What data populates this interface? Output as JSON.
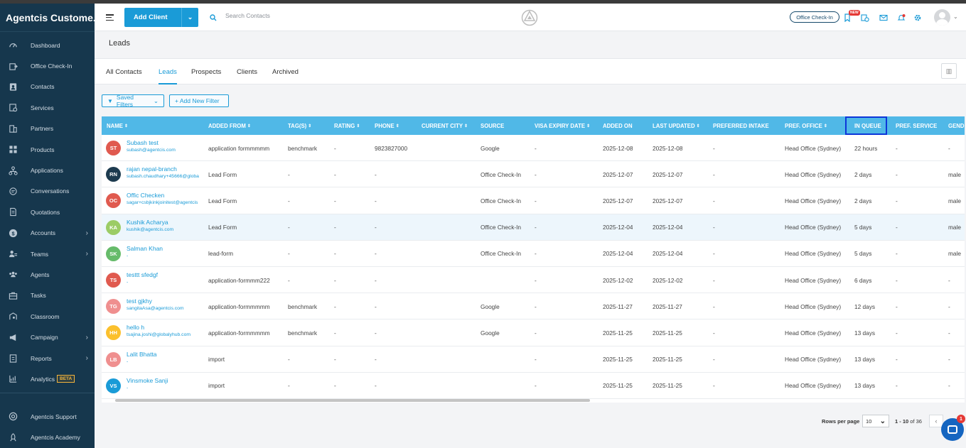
{
  "app": {
    "brand": "Agentcis Custome..."
  },
  "sidebar": {
    "items": [
      {
        "label": "Dashboard",
        "icon": "gauge-icon",
        "chev": false
      },
      {
        "label": "Office Check-In",
        "icon": "checkin-icon",
        "chev": false
      },
      {
        "label": "Contacts",
        "icon": "contacts-icon",
        "chev": false
      },
      {
        "label": "Services",
        "icon": "services-icon",
        "chev": false
      },
      {
        "label": "Partners",
        "icon": "building-icon",
        "chev": false
      },
      {
        "label": "Products",
        "icon": "grid-icon",
        "chev": false
      },
      {
        "label": "Applications",
        "icon": "flow-icon",
        "chev": false
      },
      {
        "label": "Conversations",
        "icon": "chat-icon",
        "chev": false
      },
      {
        "label": "Quotations",
        "icon": "document-icon",
        "chev": false
      },
      {
        "label": "Accounts",
        "icon": "dollar-icon",
        "chev": true
      },
      {
        "label": "Teams",
        "icon": "team-icon",
        "chev": true
      },
      {
        "label": "Agents",
        "icon": "agents-icon",
        "chev": false
      },
      {
        "label": "Tasks",
        "icon": "briefcase-icon",
        "chev": false
      },
      {
        "label": "Classroom",
        "icon": "classroom-icon",
        "chev": false
      },
      {
        "label": "Campaign",
        "icon": "megaphone-icon",
        "chev": true
      },
      {
        "label": "Reports",
        "icon": "clipboard-icon",
        "chev": true
      },
      {
        "label": "Analytics",
        "icon": "analytics-icon",
        "chev": false,
        "badge": "BETA"
      }
    ],
    "bottom": [
      {
        "label": "Agentcis Support",
        "icon": "lifebuoy-icon"
      },
      {
        "label": "Agentcis Academy",
        "icon": "rocket-icon"
      }
    ]
  },
  "topbar": {
    "add_client": "Add Client",
    "search_placeholder": "Search Contacts",
    "checkin": "Office Check-In",
    "new_badge": "NEW"
  },
  "page": {
    "title": "Leads"
  },
  "tabs": [
    "All Contacts",
    "Leads",
    "Prospects",
    "Clients",
    "Archived"
  ],
  "filters": {
    "saved": "Saved Filters",
    "add_new": "+ Add New Filter"
  },
  "table": {
    "columns": [
      "NAME",
      "ADDED FROM",
      "TAG(S)",
      "RATING",
      "PHONE",
      "CURRENT CITY",
      "SOURCE",
      "VISA EXPIRY DATE",
      "ADDED ON",
      "LAST UPDATED",
      "PREFERRED INTAKE",
      "PREF. OFFICE",
      "IN QUEUE",
      "PREF. SERVICE",
      "GEND"
    ],
    "rows": [
      {
        "initials": "ST",
        "color": "#e05a4f",
        "name": "Subash test",
        "email": "subash@agentcis.com",
        "added_from": "application formmmmm",
        "tags": "benchmark",
        "rating": "-",
        "phone": "9823827000",
        "city": "",
        "source": "Google",
        "visa": "-",
        "added_on": "2025-12-08",
        "updated": "2025-12-08",
        "intake": "-",
        "office": "Head Office (Sydney)",
        "queue": "22 hours",
        "service": "-",
        "gender": "-"
      },
      {
        "initials": "RN",
        "color": "#1d3b4f",
        "name": "rajan nepal-branch",
        "email": "subash.chaudhary+45666@globa",
        "added_from": "Lead Form",
        "tags": "-",
        "rating": "-",
        "phone": "-",
        "city": "",
        "source": "Office Check-In",
        "visa": "-",
        "added_on": "2025-12-07",
        "updated": "2025-12-07",
        "intake": "-",
        "office": "Head Office (Sydney)",
        "queue": "2 days",
        "service": "-",
        "gender": "male"
      },
      {
        "initials": "OC",
        "color": "#e05a4f",
        "name": "Offic Checken",
        "email": "sagar+csbjkinkjoinitest@agentcis",
        "added_from": "Lead Form",
        "tags": "-",
        "rating": "-",
        "phone": "-",
        "city": "",
        "source": "Office Check-In",
        "visa": "-",
        "added_on": "2025-12-07",
        "updated": "2025-12-07",
        "intake": "-",
        "office": "Head Office (Sydney)",
        "queue": "2 days",
        "service": "-",
        "gender": "male"
      },
      {
        "initials": "KA",
        "color": "#9ccc65",
        "name": "Kushik Acharya",
        "email": "kushik@agentcis.com",
        "added_from": "Lead Form",
        "tags": "-",
        "rating": "-",
        "phone": "-",
        "city": "",
        "source": "Office Check-In",
        "visa": "-",
        "added_on": "2025-12-04",
        "updated": "2025-12-04",
        "intake": "-",
        "office": "Head Office (Sydney)",
        "queue": "5 days",
        "service": "-",
        "gender": "male"
      },
      {
        "initials": "SK",
        "color": "#66bb6a",
        "name": "Salman Khan",
        "email": "-",
        "added_from": "lead-form",
        "tags": "-",
        "rating": "-",
        "phone": "-",
        "city": "",
        "source": "Office Check-In",
        "visa": "-",
        "added_on": "2025-12-04",
        "updated": "2025-12-04",
        "intake": "-",
        "office": "Head Office (Sydney)",
        "queue": "5 days",
        "service": "-",
        "gender": "male"
      },
      {
        "initials": "TS",
        "color": "#e05a4f",
        "name": "testtt sfedgf",
        "email": "-",
        "added_from": "application-formmm222",
        "tags": "-",
        "rating": "-",
        "phone": "-",
        "city": "",
        "source": "",
        "visa": "-",
        "added_on": "2025-12-02",
        "updated": "2025-12-02",
        "intake": "-",
        "office": "Head Office (Sydney)",
        "queue": "6 days",
        "service": "-",
        "gender": "-"
      },
      {
        "initials": "TG",
        "color": "#ef8f8f",
        "name": "test gjkhy",
        "email": "sangitaAsa@agentcis.com",
        "added_from": "application-formmmmm",
        "tags": "benchmark",
        "rating": "-",
        "phone": "-",
        "city": "",
        "source": "Google",
        "visa": "-",
        "added_on": "2025-11-27",
        "updated": "2025-11-27",
        "intake": "-",
        "office": "Head Office (Sydney)",
        "queue": "12 days",
        "service": "-",
        "gender": "-"
      },
      {
        "initials": "HH",
        "color": "#fbc02d",
        "name": "hello h",
        "email": "tsajina.joshi@globalyhub.com",
        "added_from": "application-formmmmm",
        "tags": "benchmark",
        "rating": "-",
        "phone": "-",
        "city": "",
        "source": "Google",
        "visa": "-",
        "added_on": "2025-11-25",
        "updated": "2025-11-25",
        "intake": "-",
        "office": "Head Office (Sydney)",
        "queue": "13 days",
        "service": "-",
        "gender": "-"
      },
      {
        "initials": "LB",
        "color": "#ef8f8f",
        "name": "Lalit Bhatta",
        "email": "-",
        "added_from": "import",
        "tags": "-",
        "rating": "-",
        "phone": "-",
        "city": "",
        "source": "",
        "visa": "-",
        "added_on": "2025-11-25",
        "updated": "2025-11-25",
        "intake": "-",
        "office": "Head Office (Sydney)",
        "queue": "13 days",
        "service": "-",
        "gender": "-"
      },
      {
        "initials": "VS",
        "color": "#1a9bd7",
        "name": "Vinsmoke Sanji",
        "email": "-",
        "added_from": "import",
        "tags": "-",
        "rating": "-",
        "phone": "-",
        "city": "",
        "source": "",
        "visa": "-",
        "added_on": "2025-11-25",
        "updated": "2025-11-25",
        "intake": "-",
        "office": "Head Office (Sydney)",
        "queue": "13 days",
        "service": "-",
        "gender": "-"
      }
    ]
  },
  "pagination": {
    "rows_label": "Rows per page",
    "rows_value": "10",
    "range": "1 - 10",
    "of": "of 36"
  },
  "chat": {
    "badge": "1"
  }
}
